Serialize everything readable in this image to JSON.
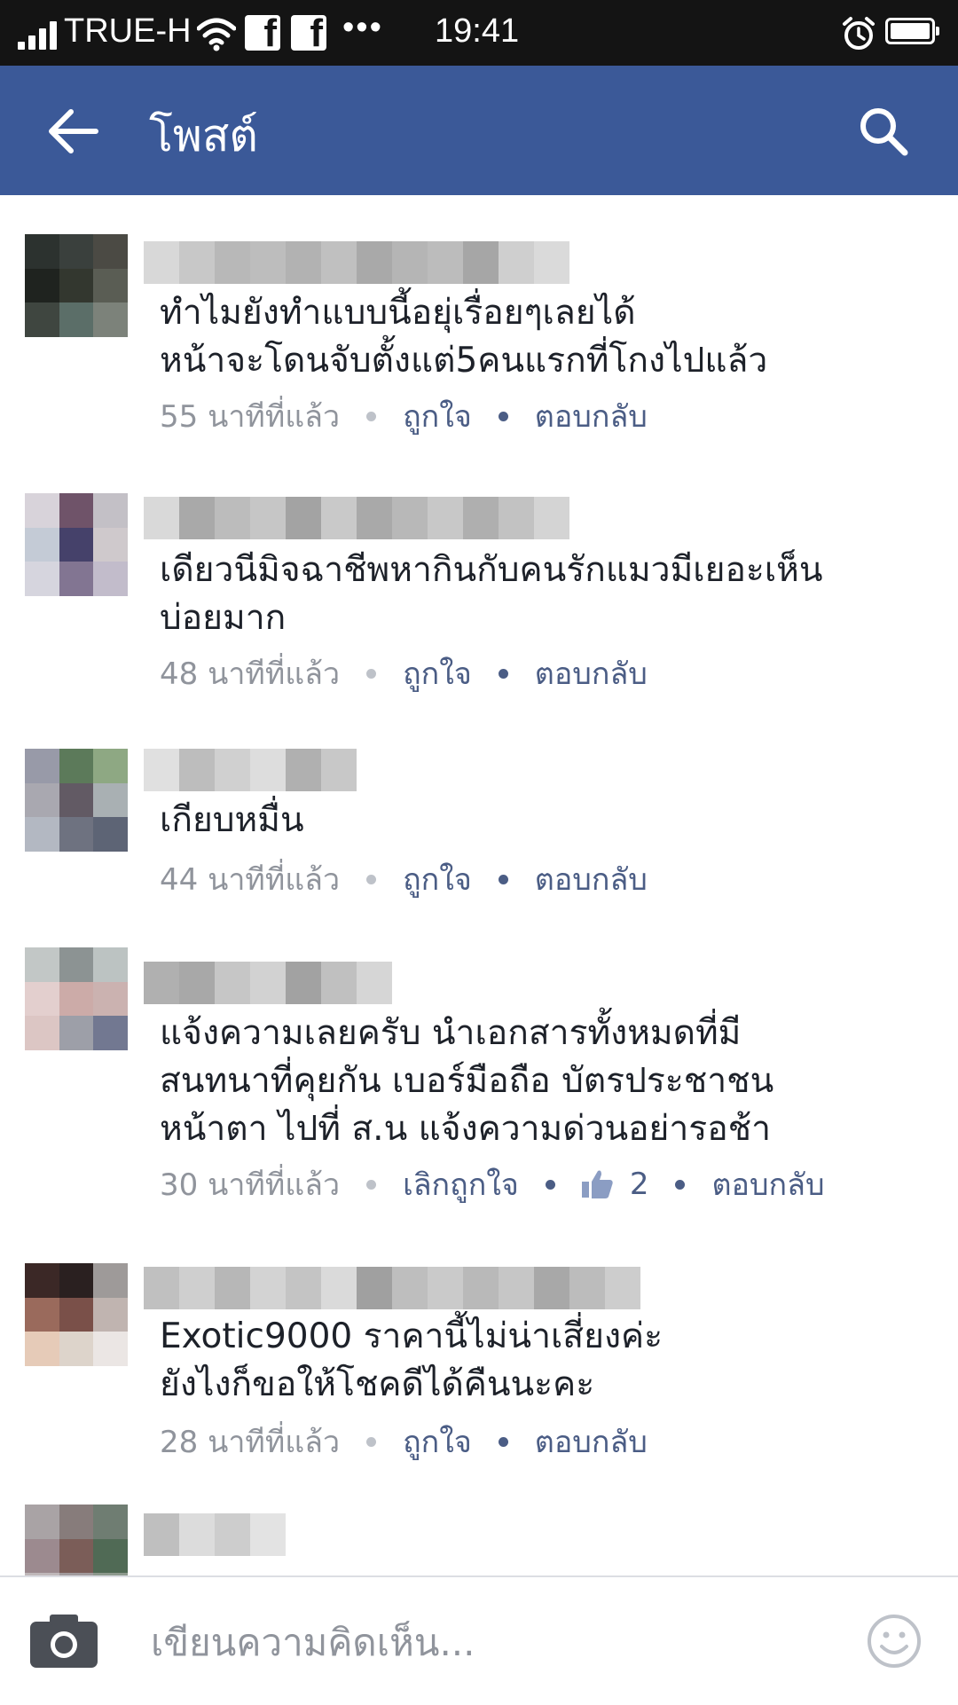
{
  "status_bar": {
    "carrier": "TRUE-H",
    "dots": "•••",
    "time": "19:41",
    "icons": [
      "signal-icon",
      "wifi-icon",
      "facebook-icon",
      "facebook-icon",
      "alarm-icon",
      "battery-icon"
    ],
    "facebook_glyph": "f"
  },
  "header": {
    "title": "โพสต์",
    "back_icon": "arrow-left-icon",
    "search_icon": "search-icon",
    "color": "#3b5998"
  },
  "comments": [
    {
      "text": "ทำไมยังทำแบบนี้อยุ่เรื่อยๆเลยได้\nหน้าจะโดนจับตั้งแต่5คนแรกที่โกงไปแล้ว",
      "time": "55 นาทีที่แล้ว",
      "like_label": "ถูกใจ",
      "reply_label": "ตอบกลับ"
    },
    {
      "text": "เดียวนีมิจฉาชีพหากินกับคนรักแมวมีเยอะเห็น\nบ่อยมาก",
      "time": "48 นาทีที่แล้ว",
      "like_label": "ถูกใจ",
      "reply_label": "ตอบกลับ"
    },
    {
      "text": "เกียบหมื่น",
      "time": "44 นาทีที่แล้ว",
      "like_label": "ถูกใจ",
      "reply_label": "ตอบกลับ"
    },
    {
      "text": "แจ้งความเลยครับ นำเอกสารทั้งหมดที่มี\nสนทนาที่คุยกัน เบอร์มือถือ บัตรประชาชน\nหน้าตา ไปที่ ส.น แจ้งความด่วนอย่ารอช้า",
      "time": "30 นาทีที่แล้ว",
      "like_label": "เลิกถูกใจ",
      "like_count": "2",
      "reply_label": "ตอบกลับ"
    },
    {
      "text": "Exotic9000 ราคานี้ไม่น่าเสี่ยงค่ะ\nยังไงก็ขอให้โชคดีได้คืนนะคะ",
      "time": "28 นาทีที่แล้ว",
      "like_label": "ถูกใจ",
      "reply_label": "ตอบกลับ"
    }
  ],
  "composer": {
    "placeholder": "เขียนความคิดเห็น...",
    "camera_icon": "camera-icon",
    "emoji_icon": "smiley-icon"
  },
  "colors": {
    "link": "#4b5d85",
    "meta": "#90949c",
    "text": "#1d2129"
  }
}
